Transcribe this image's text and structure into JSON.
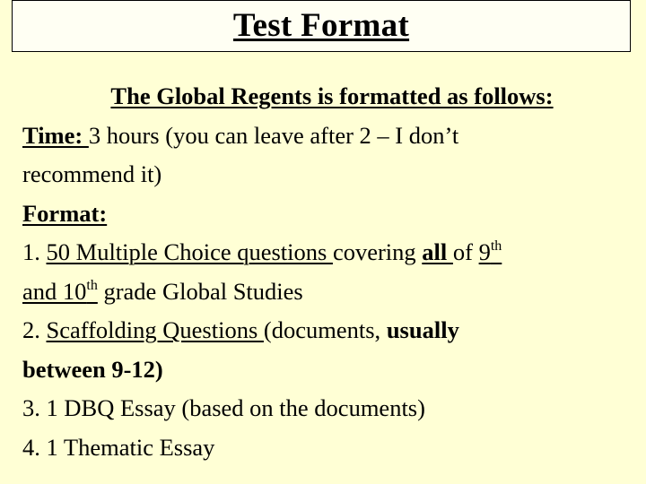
{
  "slide": {
    "title": "Test Format",
    "intro": "The Global Regents is formatted as follows:",
    "time": {
      "label": "Time: ",
      "text_1": "3 hours (you can leave after 2 – I don’t",
      "text_2": "recommend it)"
    },
    "format_label": "Format:",
    "items": [
      {
        "number": "1. ",
        "underlined": "50 Multiple Choice questions ",
        "text_a": "covering ",
        "bold_underlined": "all ",
        "text_b": "of ",
        "grade_a": "9",
        "sup_a": "th",
        "line2_grade_prefix": "and 10",
        "sup_b": "th",
        "line2_rest": " grade Global Studies"
      },
      {
        "number": "2. ",
        "underlined": "Scaffolding Questions ",
        "text_a": "(documents, ",
        "bold_a": "usually",
        "line2_bold": "between 9-12)"
      },
      {
        "number": "3. ",
        "text": "1 DBQ Essay (based on the documents)"
      },
      {
        "number": "4. ",
        "text": "1 Thematic Essay"
      }
    ],
    "colors": {
      "background": "#ffffd5",
      "title_box": "#fffff3",
      "text": "#000000"
    }
  }
}
